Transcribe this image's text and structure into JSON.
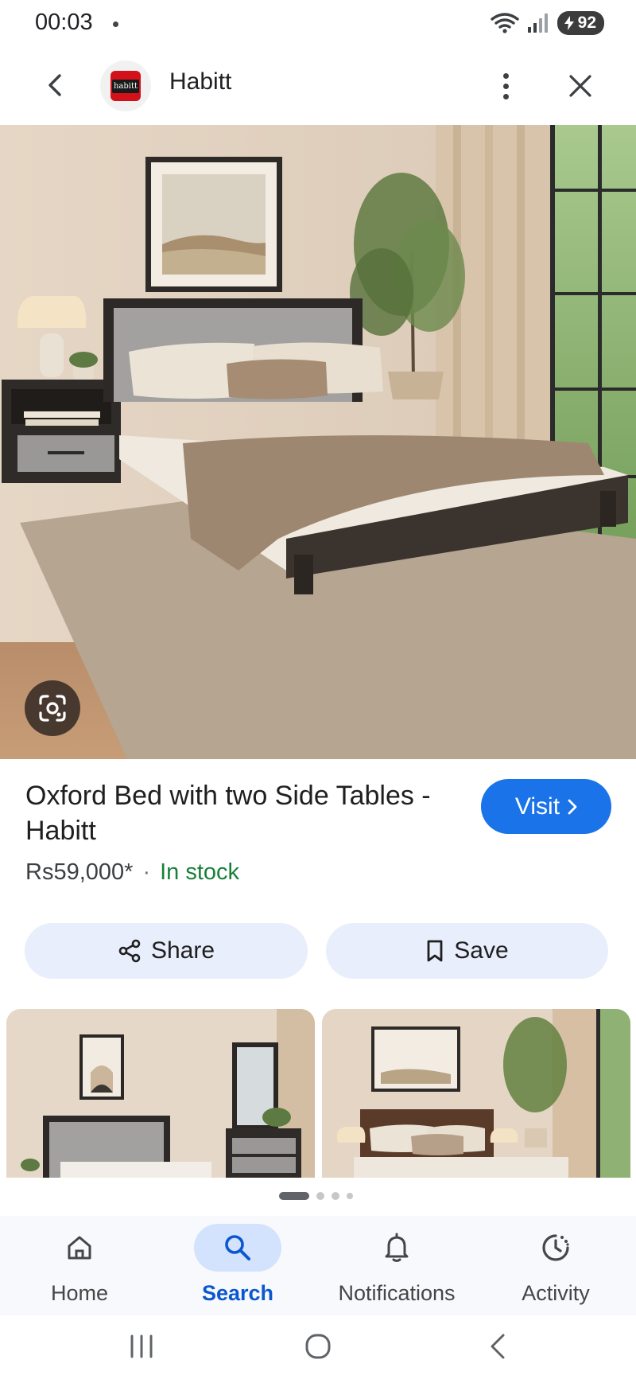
{
  "status_bar": {
    "time": "00:03",
    "battery": "92"
  },
  "header": {
    "title": "Habitt",
    "logo_text": "habitt"
  },
  "product": {
    "title": "Oxford Bed with two Side Tables - Habitt",
    "price": "Rs59,000*",
    "separator": "·",
    "stock": "In stock",
    "visit_label": "Visit"
  },
  "actions": {
    "share_label": "Share",
    "save_label": "Save"
  },
  "carousel": {
    "dots": 4,
    "active": 0
  },
  "bottom_nav": [
    {
      "label": "Home",
      "icon": "home-icon",
      "active": false
    },
    {
      "label": "Search",
      "icon": "search-icon",
      "active": true
    },
    {
      "label": "Notifications",
      "icon": "bell-icon",
      "active": false
    },
    {
      "label": "Activity",
      "icon": "activity-icon",
      "active": false
    }
  ],
  "colors": {
    "accent": "#1a73e8",
    "stock_green": "#188038",
    "action_bg": "#e8eefb",
    "nav_active_bg": "#d3e3fd",
    "nav_active_text": "#0b57d0"
  }
}
